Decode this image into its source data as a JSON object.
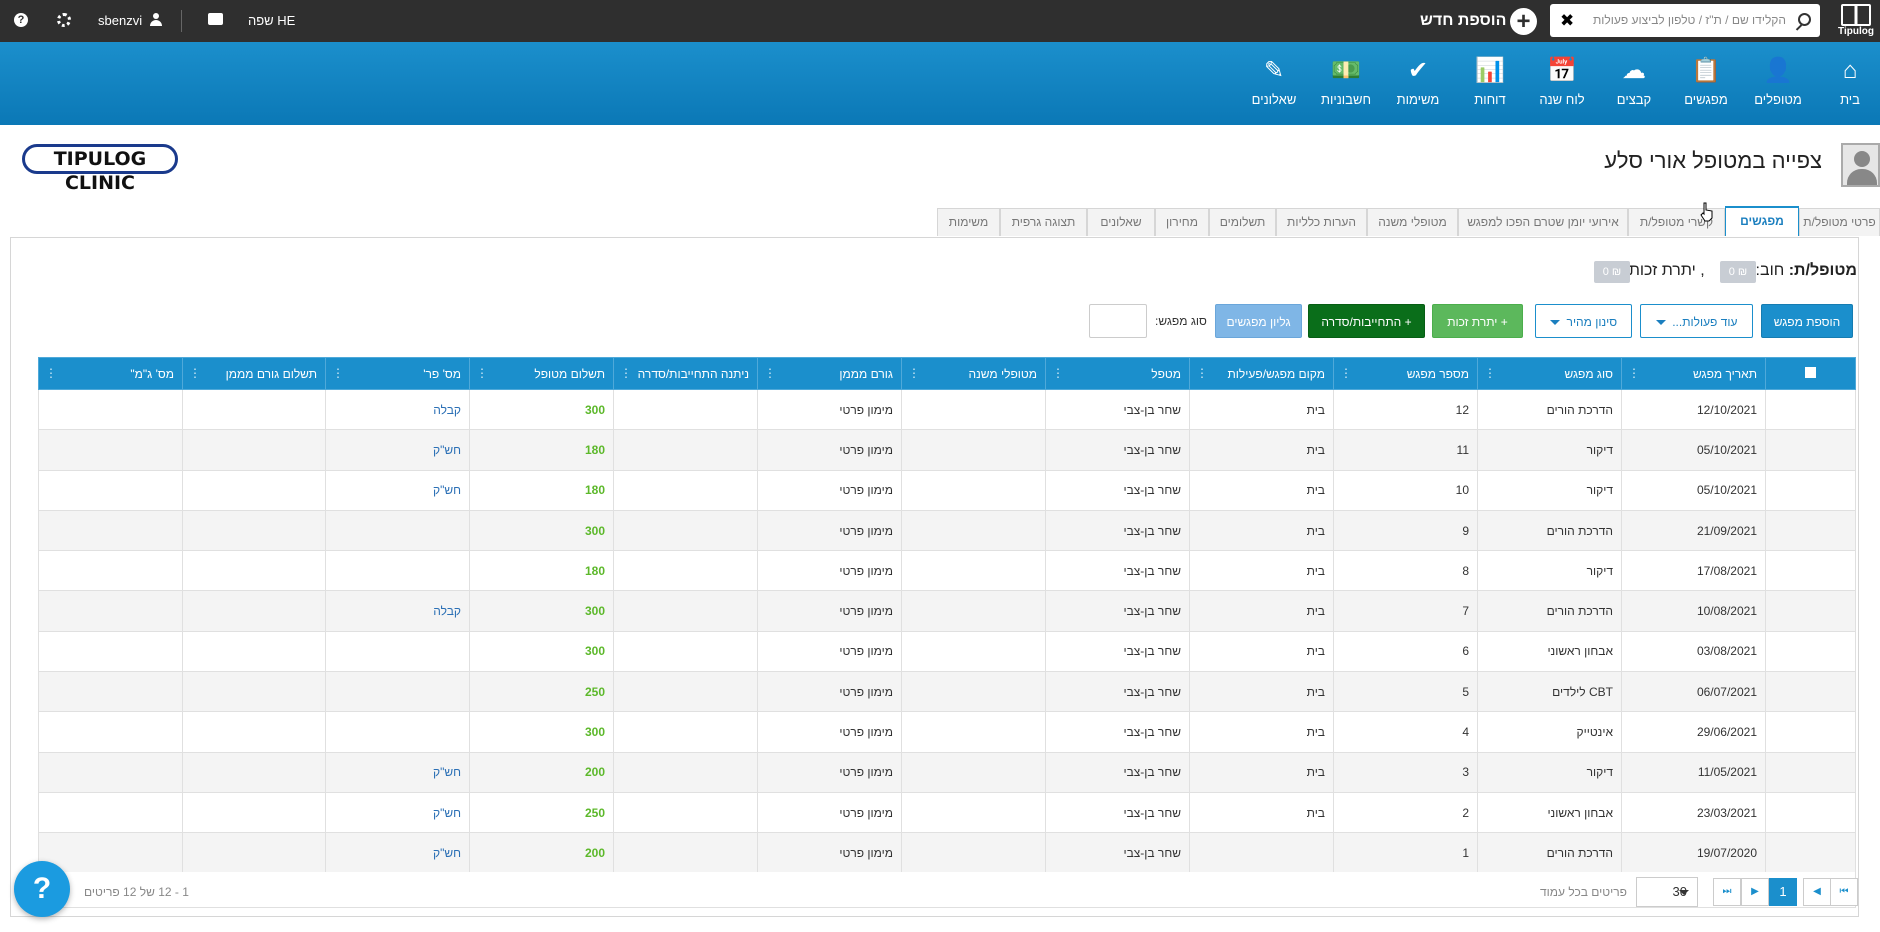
{
  "topbar": {
    "brand": "Tipulog",
    "search_placeholder": "הקלידו שם / ת\"ז / טלפון לביצוע פעולות",
    "clear_symbol": "✖",
    "add_new_label": "הוספת חדש",
    "language_label": "שפה HE",
    "username": "sbenzvi"
  },
  "nav": [
    {
      "label": "בית",
      "icon": "⌂"
    },
    {
      "label": "מטופלים",
      "icon": "👤"
    },
    {
      "label": "מפגשים",
      "icon": "📋"
    },
    {
      "label": "קבצים",
      "icon": "☁"
    },
    {
      "label": "לוח שנה",
      "icon": "📅"
    },
    {
      "label": "דוחות",
      "icon": "📊"
    },
    {
      "label": "משימות",
      "icon": "✔"
    },
    {
      "label": "חשבוניות",
      "icon": "💵"
    },
    {
      "label": "שאלונים",
      "icon": "✎"
    }
  ],
  "page": {
    "title": "צפייה במטופל אורי סלע",
    "clinic_logo_text": "TIPULOG CLINIC"
  },
  "tabs": [
    {
      "label": "פרטי מטופל/ת",
      "active": false
    },
    {
      "label": "מפגשים",
      "active": true
    },
    {
      "label": "קשרי מטופל/ת",
      "active": false
    },
    {
      "label": "אירועי יומן שטרם הפכו למפגש",
      "active": false
    },
    {
      "label": "מטופלי משנה",
      "active": false
    },
    {
      "label": "הערות כלליות",
      "active": false
    },
    {
      "label": "תשלומים",
      "active": false
    },
    {
      "label": "מחירון",
      "active": false
    },
    {
      "label": "שאלונים",
      "active": false
    },
    {
      "label": "תצוגה גרפית",
      "active": false
    },
    {
      "label": "משימות",
      "active": false
    }
  ],
  "balance": {
    "label": "מטופל/ת:",
    "debt_label": "חוב:",
    "debt_value": "0 ₪",
    "credit_label": ", יתרת זכות:",
    "credit_value": "0 ₪"
  },
  "actions": {
    "add_meeting": "הוספת מפגש",
    "more_actions": "עוד פעולות...",
    "quick_filter": "סינון מהיר",
    "credit_balance": "+ יתרת זכות",
    "commitment": "+ התחייבות/סדרה",
    "meetings_sheet": "גליון מפגשים",
    "meeting_type_label": "סוג מפגש:"
  },
  "table": {
    "columns": [
      "תאריך מפגש",
      "סוג מפגש",
      "מספר מפגש",
      "מקום מפגש/פעילות",
      "מטפל",
      "מטופלי משנה",
      "גורם מממן",
      "ניתנה התחייבות/סדרה",
      "תשלום מטופל",
      "מס' פר'",
      "תשלום גורם מממן",
      "מס' ג\"מ\""
    ],
    "rows": [
      {
        "date": "12/10/2021",
        "type": "הדרכת הורים",
        "num": "12",
        "place": "בית",
        "therapist": "שחר בן-צבי",
        "sub": "",
        "funder": "מימון פרטי",
        "commit": "",
        "pay": "300",
        "receipt": "קבלה",
        "funder_pay": "",
        "funder_no": ""
      },
      {
        "date": "05/10/2021",
        "type": "דיקור",
        "num": "11",
        "place": "בית",
        "therapist": "שחר בן-צבי",
        "sub": "",
        "funder": "מימון פרטי",
        "commit": "",
        "pay": "180",
        "receipt": "חש\"ק",
        "funder_pay": "",
        "funder_no": ""
      },
      {
        "date": "05/10/2021",
        "type": "דיקור",
        "num": "10",
        "place": "בית",
        "therapist": "שחר בן-צבי",
        "sub": "",
        "funder": "מימון פרטי",
        "commit": "",
        "pay": "180",
        "receipt": "חש\"ק",
        "funder_pay": "",
        "funder_no": ""
      },
      {
        "date": "21/09/2021",
        "type": "הדרכת הורים",
        "num": "9",
        "place": "בית",
        "therapist": "שחר בן-צבי",
        "sub": "",
        "funder": "מימון פרטי",
        "commit": "",
        "pay": "300",
        "receipt": "",
        "funder_pay": "",
        "funder_no": ""
      },
      {
        "date": "17/08/2021",
        "type": "דיקור",
        "num": "8",
        "place": "בית",
        "therapist": "שחר בן-צבי",
        "sub": "",
        "funder": "מימון פרטי",
        "commit": "",
        "pay": "180",
        "receipt": "",
        "funder_pay": "",
        "funder_no": ""
      },
      {
        "date": "10/08/2021",
        "type": "הדרכת הורים",
        "num": "7",
        "place": "בית",
        "therapist": "שחר בן-צבי",
        "sub": "",
        "funder": "מימון פרטי",
        "commit": "",
        "pay": "300",
        "receipt": "קבלה",
        "funder_pay": "",
        "funder_no": ""
      },
      {
        "date": "03/08/2021",
        "type": "אבחון ראשוני",
        "num": "6",
        "place": "בית",
        "therapist": "שחר בן-צבי",
        "sub": "",
        "funder": "מימון פרטי",
        "commit": "",
        "pay": "300",
        "receipt": "",
        "funder_pay": "",
        "funder_no": ""
      },
      {
        "date": "06/07/2021",
        "type": "CBT לילדים",
        "num": "5",
        "place": "בית",
        "therapist": "שחר בן-צבי",
        "sub": "",
        "funder": "מימון פרטי",
        "commit": "",
        "pay": "250",
        "receipt": "",
        "funder_pay": "",
        "funder_no": ""
      },
      {
        "date": "29/06/2021",
        "type": "אינטייק",
        "num": "4",
        "place": "בית",
        "therapist": "שחר בן-צבי",
        "sub": "",
        "funder": "מימון פרטי",
        "commit": "",
        "pay": "300",
        "receipt": "",
        "funder_pay": "",
        "funder_no": ""
      },
      {
        "date": "11/05/2021",
        "type": "דיקור",
        "num": "3",
        "place": "בית",
        "therapist": "שחר בן-צבי",
        "sub": "",
        "funder": "מימון פרטי",
        "commit": "",
        "pay": "200",
        "receipt": "חש\"ק",
        "funder_pay": "",
        "funder_no": ""
      },
      {
        "date": "23/03/2021",
        "type": "אבחון ראשוני",
        "num": "2",
        "place": "בית",
        "therapist": "שחר בן-צבי",
        "sub": "",
        "funder": "מימון פרטי",
        "commit": "",
        "pay": "250",
        "receipt": "חש\"ק",
        "funder_pay": "",
        "funder_no": ""
      },
      {
        "date": "19/07/2020",
        "type": "הדרכת הורים",
        "num": "1",
        "place": "",
        "therapist": "שחר בן-צבי",
        "sub": "",
        "funder": "מימון פרטי",
        "commit": "",
        "pay": "200",
        "receipt": "חש\"ק",
        "funder_pay": "",
        "funder_no": ""
      }
    ]
  },
  "pager": {
    "current_page": "1",
    "page_size": "30",
    "per_page_label": "פריטים בכל עמוד",
    "range_text": "1 - 12 של 12 פריטים"
  },
  "help_label": "?",
  "colors": {
    "brand_blue": "#1b8fcc",
    "topbar": "#2f2f2f",
    "pay_green": "#5cb82a",
    "dark_green": "#0a6e1a"
  }
}
